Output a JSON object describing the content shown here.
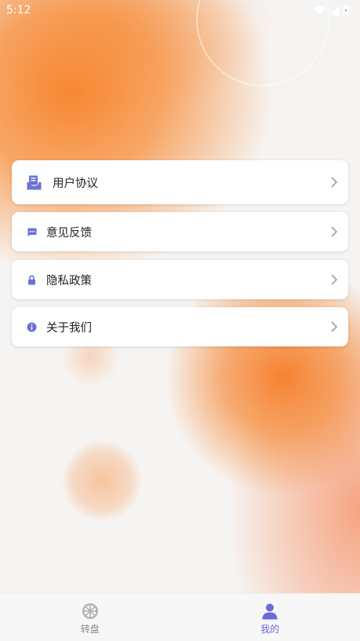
{
  "status_bar": {
    "time": "5:12",
    "icons": [
      "wifi-icon",
      "cell-signal-icon",
      "battery-icon"
    ]
  },
  "menu": {
    "items": [
      {
        "label": "用户协议",
        "icon": "user-agreement-icon"
      },
      {
        "label": "意见反馈",
        "icon": "feedback-chat-icon"
      },
      {
        "label": "隐私政策",
        "icon": "lock-icon"
      },
      {
        "label": "关于我们",
        "icon": "info-icon"
      }
    ],
    "chevron_icon": "chevron-right-icon"
  },
  "tabbar": {
    "tabs": [
      {
        "label": "转盘",
        "icon": "wheel-icon",
        "active": false
      },
      {
        "label": "我的",
        "icon": "person-icon",
        "active": true
      }
    ]
  },
  "colors": {
    "accent": "#6a6ad8",
    "icon_blue": "#6b72d6",
    "orange_bg": "#f78228",
    "tab_inactive": "#8a8a8a"
  }
}
